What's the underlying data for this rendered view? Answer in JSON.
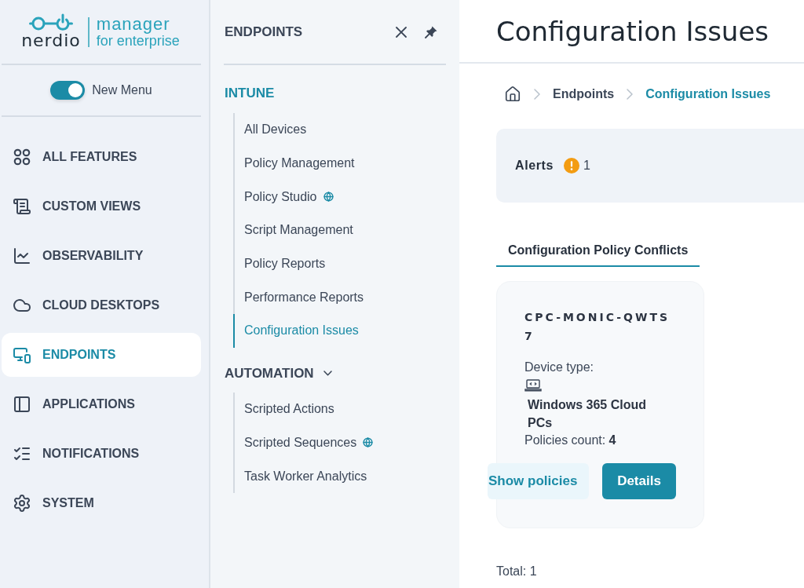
{
  "logo": {
    "wordmark": "nerdio",
    "product": [
      "manager",
      "for enterprise"
    ]
  },
  "new_menu_toggle": {
    "label": "New Menu",
    "on": true
  },
  "main_nav": [
    {
      "label": "ALL FEATURES",
      "selected": false
    },
    {
      "label": "CUSTOM VIEWS",
      "selected": false
    },
    {
      "label": "OBSERVABILITY",
      "selected": false
    },
    {
      "label": "CLOUD DESKTOPS",
      "selected": false
    },
    {
      "label": "ENDPOINTS",
      "selected": true
    },
    {
      "label": "APPLICATIONS",
      "selected": false
    },
    {
      "label": "NOTIFICATIONS",
      "selected": false
    },
    {
      "label": "SYSTEM",
      "selected": false
    }
  ],
  "submenu": {
    "title": "ENDPOINTS",
    "sections": [
      {
        "title": "INTUNE",
        "kind": "current",
        "items": [
          {
            "label": "All Devices",
            "selected": false,
            "badge": false
          },
          {
            "label": "Policy Management",
            "selected": false,
            "badge": false
          },
          {
            "label": "Policy Studio",
            "selected": false,
            "badge": true
          },
          {
            "label": "Script Management",
            "selected": false,
            "badge": false
          },
          {
            "label": "Policy Reports",
            "selected": false,
            "badge": false
          },
          {
            "label": "Performance Reports",
            "selected": false,
            "badge": false
          },
          {
            "label": "Configuration Issues",
            "selected": true,
            "badge": false
          }
        ]
      },
      {
        "title": "AUTOMATION",
        "kind": "collapsible",
        "items": [
          {
            "label": "Scripted Actions",
            "selected": false,
            "badge": false
          },
          {
            "label": "Scripted Sequences",
            "selected": false,
            "badge": true
          },
          {
            "label": "Task Worker Analytics",
            "selected": false,
            "badge": false
          }
        ]
      }
    ]
  },
  "page": {
    "title": "Configuration Issues",
    "breadcrumb": [
      {
        "label": "Endpoints",
        "selected": false
      },
      {
        "label": "Configuration Issues",
        "selected": true
      }
    ],
    "alerts": {
      "label": "Alerts",
      "count": "1"
    },
    "tabs": [
      {
        "label": "Configuration Policy Conflicts",
        "selected": true
      }
    ],
    "cards": [
      {
        "device_name": "CPC-MONIC-QWTS7",
        "device_type_label": "Device type:",
        "device_type": "Windows 365 Cloud PCs",
        "policies": "Policies count: **4**",
        "buttons": [
          {
            "label": "Show policies",
            "kind": "secondary"
          },
          {
            "label": "Details",
            "kind": "primary"
          }
        ]
      }
    ],
    "total": "Total: 1"
  }
}
